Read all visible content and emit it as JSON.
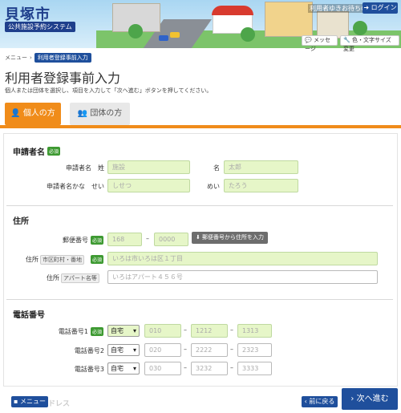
{
  "header": {
    "site_title": "貝塚市",
    "site_subtitle": "公共施設予約システム",
    "welcome": "利用者ゆきお待ちの方",
    "login": "ログイン",
    "message": "メッセージ",
    "font_size": "色・文字サイズ変更"
  },
  "breadcrumb": {
    "menu": "メニュー",
    "sep": "›",
    "current": "利用者登録事前入力"
  },
  "page": {
    "title": "利用者登録事前入力",
    "intro": "個人または団体を選択し、項目を入力して「次へ進む」ボタンを押してください。"
  },
  "tabs": {
    "individual": "個人の方",
    "group": "団体の方"
  },
  "required": "必須",
  "applicant": {
    "title": "申請者名",
    "name_label": "申請者名　姓",
    "surname_placeholder": "施設",
    "given_label": "名",
    "given_placeholder": "太郎",
    "kana_label": "申請者名かな　せい",
    "kana_surname_placeholder": "しせつ",
    "kana_given_label": "めい",
    "kana_given_placeholder": "たろう"
  },
  "address": {
    "title": "住所",
    "postal_label": "郵便番号",
    "postal1_placeholder": "168",
    "postal2_placeholder": "0000",
    "postal_button": "郵便番号から住所を入力",
    "addr_label": "住所",
    "addr_tag": "市区町村・番地",
    "addr_placeholder": "いろは市いろは区１丁目",
    "apt_label": "住所",
    "apt_tag": "アパート名等",
    "apt_placeholder": "いろはアパート４５６号"
  },
  "phone": {
    "title": "電話番号",
    "rows": [
      {
        "label": "電話番号1",
        "type": "自宅",
        "p1": "010",
        "p2": "1212",
        "p3": "1313"
      },
      {
        "label": "電話番号2",
        "type": "自宅",
        "p1": "020",
        "p2": "2222",
        "p3": "2323"
      },
      {
        "label": "電話番号3",
        "type": "自宅",
        "p1": "030",
        "p2": "3232",
        "p3": "3333"
      }
    ]
  },
  "footer": {
    "menu": "メニュー",
    "faded": "ドレス",
    "back": "前に戻る",
    "next": "次へ進む"
  }
}
